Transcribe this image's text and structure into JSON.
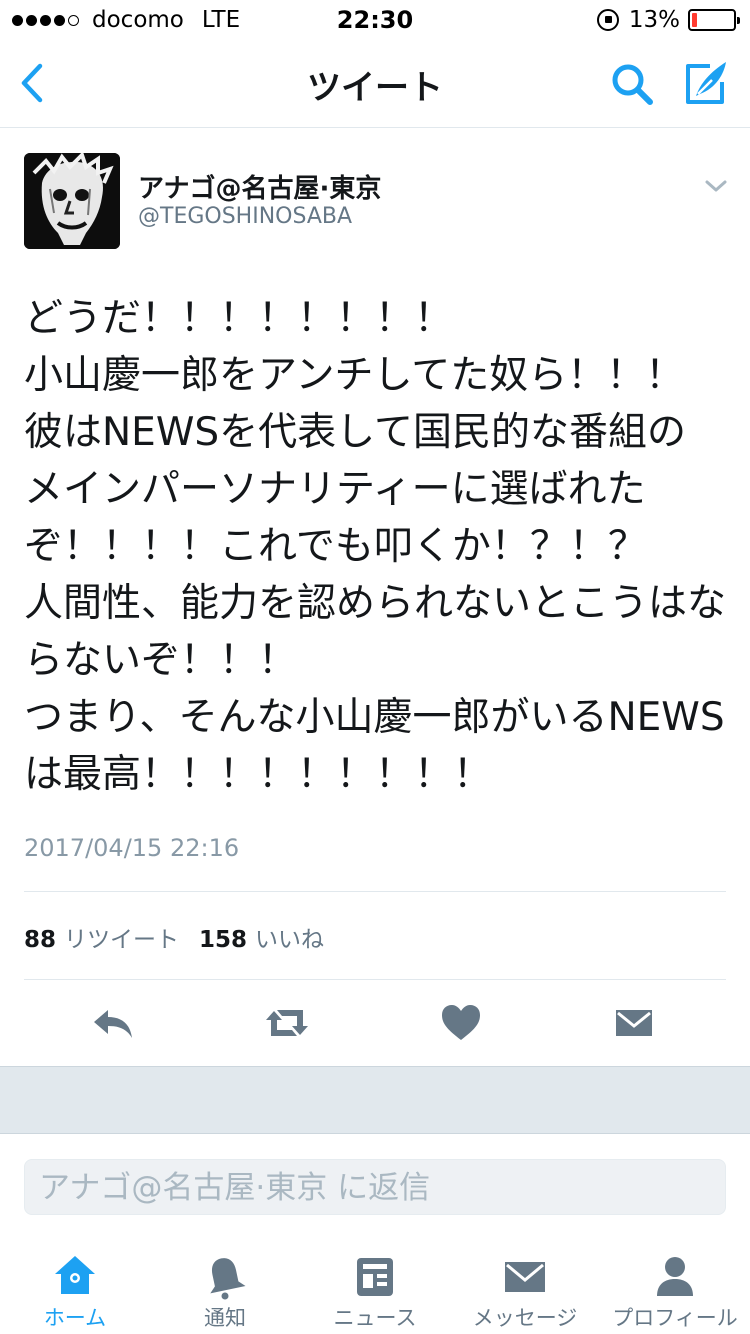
{
  "status_bar": {
    "signal_dots_filled": 4,
    "signal_dots_total": 5,
    "carrier": "docomo",
    "network": "LTE",
    "time": "22:30",
    "battery_percent": "13%",
    "battery_level": 0.13,
    "battery_color": "#ff3b30"
  },
  "nav": {
    "title": "ツイート",
    "back_icon": "chevron-left-icon",
    "search_icon": "search-icon",
    "compose_icon": "compose-icon",
    "accent": "#1da1f2"
  },
  "tweet": {
    "display_name": "アナゴ@名古屋·東京",
    "handle": "@TEGOSHINOSABA",
    "text": "どうだ！！！！！！！！\n小山慶一郎をアンチしてた奴ら！！！\n彼はNEWSを代表して国民的な番組の\nメインパーソナリティーに選ばれた\nぞ！！！！これでも叩くか！？！？\n人間性、能力を認められないとこうはな\nらないぞ！！！\nつまり、そんな小山慶一郎がいるNEWS\nは最高！！！！！！！！！",
    "timestamp": "2017/04/15 22:16",
    "retweets": "88",
    "retweets_label": "リツイート",
    "likes": "158",
    "likes_label": "いいね"
  },
  "actions": {
    "reply_icon": "reply-icon",
    "retweet_icon": "retweet-icon",
    "like_icon": "heart-icon",
    "dm_icon": "envelope-icon",
    "icon_color": "#657786"
  },
  "reply": {
    "placeholder": "アナゴ@名古屋·東京 に返信"
  },
  "tabs": [
    {
      "label": "ホーム",
      "icon": "home-icon",
      "active": true
    },
    {
      "label": "通知",
      "icon": "bell-icon",
      "active": false
    },
    {
      "label": "ニュース",
      "icon": "news-icon",
      "active": false
    },
    {
      "label": "メッセージ",
      "icon": "envelope-icon",
      "active": false
    },
    {
      "label": "プロフィール",
      "icon": "person-icon",
      "active": false
    }
  ]
}
